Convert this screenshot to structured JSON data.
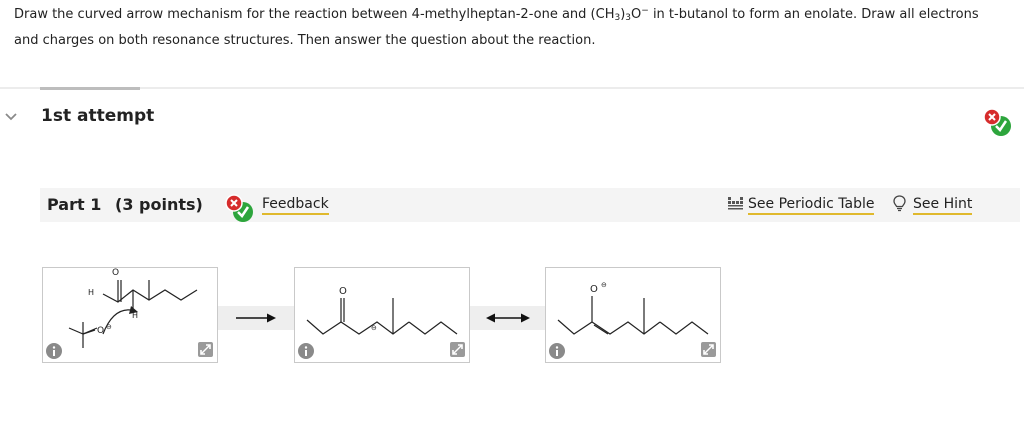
{
  "question": {
    "line1_prefix": "Draw the curved arrow mechanism for the reaction between 4-methylheptan-2-one and (CH",
    "sub1": "3",
    "paren": ")",
    "sub2": "3",
    "o": "O",
    "sup": "−",
    "line1_suffix": " in t-butanol to form an enolate. Draw all electrons",
    "line2": "and charges on both resonance structures. Then answer the question about the reaction."
  },
  "attempt": {
    "label": "1st attempt"
  },
  "part": {
    "label": "Part 1",
    "points": "(3 points)",
    "feedback_link": "Feedback",
    "periodic_table_link": "See Periodic Table",
    "hint_link": "See Hint"
  },
  "molecules": {
    "oxygen": "O",
    "hydrogen": "H",
    "minus": "⊖"
  },
  "icons": {
    "info": "info-icon",
    "expand": "expand-icon",
    "status": "x-check-badge",
    "periodic": "periodic-table-icon",
    "hint": "lightbulb-icon"
  },
  "colors": {
    "accent_underline": "#e0b92d",
    "error_red": "#d62c2c",
    "success_green": "#2da53c",
    "icon_gray": "#8a8a8a"
  }
}
